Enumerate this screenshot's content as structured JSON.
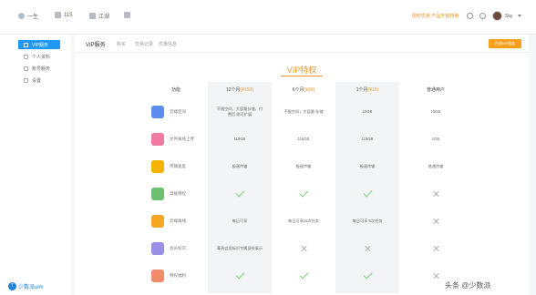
{
  "topbar": {
    "items": [
      {
        "label": "一生",
        "icon": "user-icon"
      },
      {
        "label": "115",
        "icon": "cloud-icon"
      },
      {
        "label": "江湖",
        "icon": "chat-icon"
      },
      {
        "label": "",
        "icon": "grid-icon"
      }
    ],
    "promo_link": "限时优惠 产品升级特惠",
    "username": "Sky"
  },
  "sidebar": {
    "items": [
      {
        "label": "VIP服务",
        "icon": "diamond-icon",
        "active": true
      },
      {
        "label": "个人资料",
        "icon": "profile-icon",
        "active": false
      },
      {
        "label": "账号服务",
        "icon": "account-icon",
        "active": false
      },
      {
        "label": "设置",
        "icon": "settings-icon",
        "active": false
      }
    ],
    "badge": "少数派uim"
  },
  "main": {
    "tabs": [
      {
        "label": "VIP服务",
        "active": true
      },
      {
        "label": "购买",
        "active": false
      },
      {
        "label": "交易记录",
        "active": false
      },
      {
        "label": "优惠信息",
        "active": false
      }
    ],
    "open_button": "开通VIP服务",
    "section_title": "VIP特权"
  },
  "table": {
    "headers": [
      {
        "label": "功能"
      },
      {
        "label": "12个月",
        "price": "¥150"
      },
      {
        "label": "6个月",
        "price": "¥90"
      },
      {
        "label": "1个月",
        "price": "¥15"
      },
      {
        "label": "普通用户"
      }
    ],
    "rows": [
      {
        "feature": "云端空间",
        "icon_color": "#5b8def",
        "cells": [
          {
            "type": "text",
            "value": "不限空间，大容量存储，付费后 即可扩展"
          },
          {
            "type": "text",
            "value": "不限空间，大容量 存储"
          },
          {
            "type": "text",
            "value": "15GB"
          },
          {
            "type": "text",
            "value": "15GB"
          }
        ]
      },
      {
        "feature": "文件离线上传",
        "icon_color": "#ef7aa0",
        "cells": [
          {
            "type": "text",
            "value": "115GB"
          },
          {
            "type": "text",
            "value": "115GB"
          },
          {
            "type": "text",
            "value": "115GB"
          },
          {
            "type": "text",
            "value": "1GB"
          }
        ]
      },
      {
        "feature": "传输速度",
        "icon_color": "#f5b100",
        "cells": [
          {
            "type": "text",
            "value": "极速传输"
          },
          {
            "type": "text",
            "value": "极速传输"
          },
          {
            "type": "text",
            "value": "极速传输"
          },
          {
            "type": "text",
            "value": "普通传输"
          }
        ]
      },
      {
        "feature": "高级特权",
        "icon_color": "#6cc070",
        "cells": [
          {
            "type": "check"
          },
          {
            "type": "check"
          },
          {
            "type": "check"
          },
          {
            "type": "cross"
          }
        ]
      },
      {
        "feature": "云端离线",
        "icon_color": "#f5a623",
        "cells": [
          {
            "type": "text",
            "value": "每日可享"
          },
          {
            "type": "text",
            "value": "每日可享15次任务"
          },
          {
            "type": "text",
            "value": "每日可享 5次任务"
          },
          {
            "type": "cross"
          }
        ]
      },
      {
        "feature": "会员标识",
        "icon_color": "#9b8fe8",
        "cells": [
          {
            "type": "text",
            "value": "尊贵会员标识专属身份展示"
          },
          {
            "type": "cross"
          },
          {
            "type": "cross"
          },
          {
            "type": "cross"
          }
        ]
      },
      {
        "feature": "特权福利",
        "icon_color": "#f08c6a",
        "cells": [
          {
            "type": "check"
          },
          {
            "type": "check"
          },
          {
            "type": "check"
          },
          {
            "type": "cross"
          }
        ]
      }
    ]
  },
  "watermark": "头条 @少数派"
}
